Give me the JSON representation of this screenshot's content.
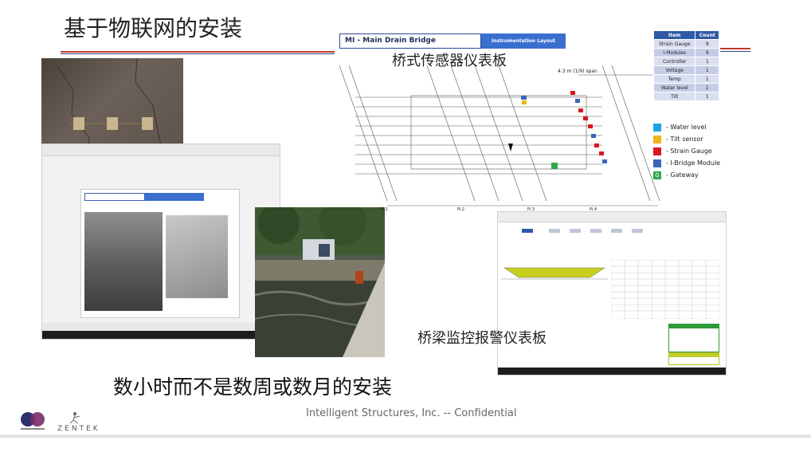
{
  "slide": {
    "title": "基于物联网的安装",
    "bridge_layout_title": "MI - Main Drain Bridge",
    "bridge_layout_subtitle": "Instrumentation Layout",
    "dashboard_caption": "桥式传感器仪表板",
    "alarm_caption": "桥梁监控报警仪表板",
    "headline": "数小时而不是数周或数月的安装",
    "footer": "Intelligent Structures, Inc.  --  Confidential",
    "span_label": "4.3 m (1/9) span",
    "pier_labels": [
      "Pi.1",
      "Pi.2",
      "Pi.3",
      "Pi.4"
    ],
    "logo_word": "ZENTEK"
  },
  "sensor_table": {
    "headers": [
      "Item",
      "Count"
    ],
    "rows": [
      {
        "item": "Strain Gauge",
        "count": "9"
      },
      {
        "item": "I-Modules",
        "count": "9"
      },
      {
        "item": "Controller",
        "count": "1"
      },
      {
        "item": "Voltage",
        "count": "1"
      },
      {
        "item": "Temp",
        "count": "1"
      },
      {
        "item": "Water level",
        "count": "1"
      },
      {
        "item": "Tilt",
        "count": "1"
      }
    ]
  },
  "legend": [
    {
      "label": "- Water level",
      "color": "#1ea5e0",
      "icon": "square"
    },
    {
      "label": "- Tilt sensor",
      "color": "#f2b418",
      "icon": "square"
    },
    {
      "label": "- Strain Gauge",
      "color": "#d71920",
      "icon": "square"
    },
    {
      "label": "- I-Bridge Module",
      "color": "#3a66b8",
      "icon": "square"
    },
    {
      "label": "- Gateway",
      "color": "#2fa84f",
      "icon": "G"
    }
  ],
  "colors": {
    "accent_red": "#c0392b",
    "accent_navy": "#2c3e7a",
    "header_blue": "#3a6fd0"
  }
}
